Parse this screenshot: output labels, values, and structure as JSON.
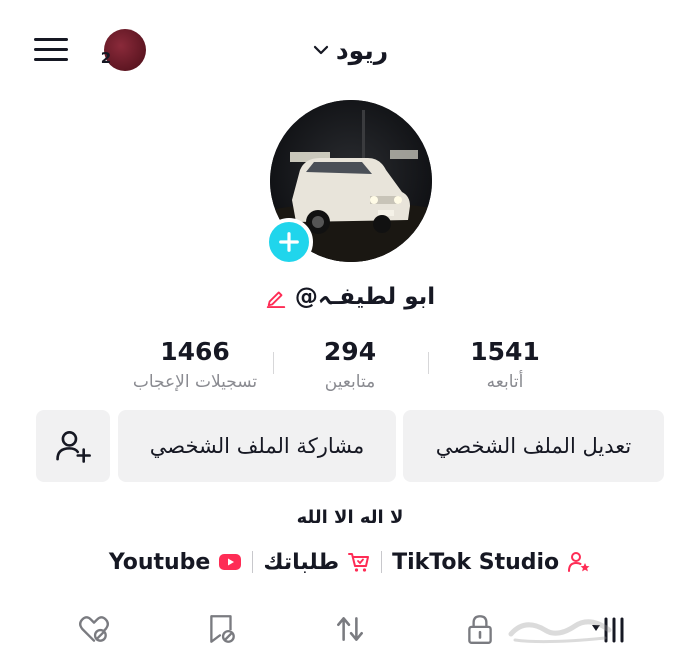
{
  "header": {
    "username": "ريود",
    "notification_count": "2"
  },
  "profile": {
    "handle": "@ابو لطيفـہ",
    "bio": "لا اله الا الله"
  },
  "stats": {
    "following": {
      "value": "1541",
      "label": "أتابعه"
    },
    "followers": {
      "value": "294",
      "label": "متابعين"
    },
    "likes": {
      "value": "1466",
      "label": "تسجيلات الإعجاب"
    }
  },
  "actions": {
    "edit_profile": "تعديل الملف الشخصي",
    "share_profile": "مشاركة الملف الشخصي"
  },
  "links": [
    {
      "label": "TikTok Studio",
      "icon": "user-star-icon"
    },
    {
      "label": "طلباتك",
      "icon": "cart-icon"
    },
    {
      "label": "Youtube",
      "icon": "youtube-icon"
    }
  ],
  "colors": {
    "accent_pink": "#fe2c55",
    "add_story_cyan": "#20d5ec",
    "button_bg": "#f1f1f2",
    "muted_text": "#8a8b91"
  },
  "tabs": [
    "videos-icon",
    "lock-icon",
    "repost-icon",
    "favorites-icon",
    "liked-icon"
  ]
}
